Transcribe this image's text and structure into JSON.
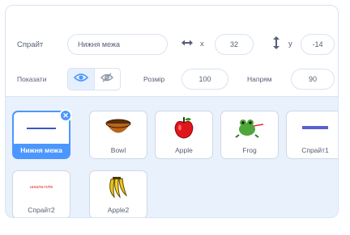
{
  "sprite_info": {
    "sprite_label": "Спрайт",
    "sprite_name": "Нижня межа",
    "x_label": "x",
    "x_value": "32",
    "y_label": "y",
    "y_value": "-14",
    "show_label": "Показати",
    "size_label": "Розмір",
    "size_value": "100",
    "direction_label": "Напрям",
    "direction_value": "90"
  },
  "sprites": [
    {
      "name": "Нижня межа",
      "selected": true,
      "thumb": "line-icon"
    },
    {
      "name": "Bowl",
      "selected": false,
      "thumb": "bowl-icon"
    },
    {
      "name": "Apple",
      "selected": false,
      "thumb": "apple-icon"
    },
    {
      "name": "Frog",
      "selected": false,
      "thumb": "frog-icon"
    },
    {
      "name": "Спрайт1",
      "selected": false,
      "thumb": "bar-icon"
    },
    {
      "name": "Спрайт2",
      "selected": false,
      "thumb": "text-icon",
      "thumb_text": "шкала-плік"
    },
    {
      "name": "Apple2",
      "selected": false,
      "thumb": "bananas-icon"
    }
  ],
  "colors": {
    "accent": "#4c97ff",
    "panel": "#e9f1fc",
    "text": "#575e75"
  }
}
